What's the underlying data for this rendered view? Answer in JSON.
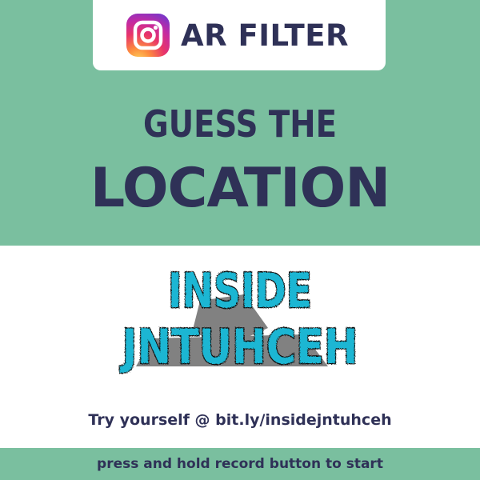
{
  "badge": {
    "icon": "instagram-icon",
    "label": "AR FILTER"
  },
  "headline": {
    "line1": "GUESS THE",
    "line2": "LOCATION"
  },
  "logo": {
    "line1": "INSIDE",
    "line2": "JNTUHCEH"
  },
  "try_text": "Try yourself @ bit.ly/insidejntuhceh",
  "bottom_text": "press and hold record button to start",
  "colors": {
    "band": "#7abf9f",
    "text": "#2f3157",
    "logo": "#1fb6d3"
  }
}
